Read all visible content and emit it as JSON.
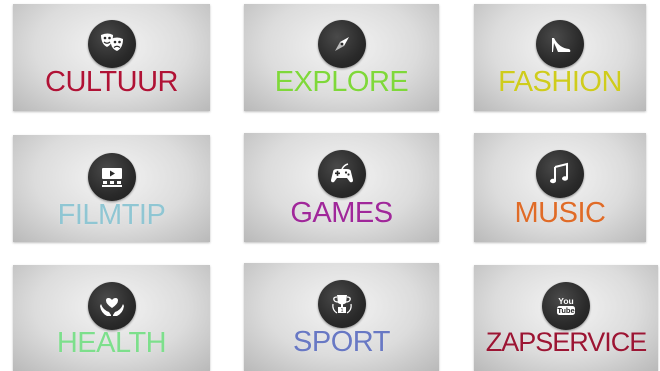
{
  "tiles": [
    {
      "label": "CULTUUR",
      "icon": "theater-masks-icon",
      "color": "#b01235"
    },
    {
      "label": "EXPLORE",
      "icon": "compass-icon",
      "color": "#7fd83a"
    },
    {
      "label": "FASHION",
      "icon": "high-heel-icon",
      "color": "#cfcc1c"
    },
    {
      "label": "FILMTIP",
      "icon": "cinema-screen-icon",
      "color": "#8fc6d3"
    },
    {
      "label": "GAMES",
      "icon": "gamepad-icon",
      "color": "#a0279a"
    },
    {
      "label": "MUSIC",
      "icon": "music-notes-icon",
      "color": "#e06b27"
    },
    {
      "label": "HEALTH",
      "icon": "heart-hands-icon",
      "color": "#7ddf8c"
    },
    {
      "label": "SPORT",
      "icon": "trophy-icon",
      "color": "#6878c4"
    },
    {
      "label": "ZAPSERVICE",
      "icon": "youtube-icon",
      "color": "#9c1533",
      "icon_text_top": "You",
      "icon_text_bottom": "Tube"
    }
  ]
}
